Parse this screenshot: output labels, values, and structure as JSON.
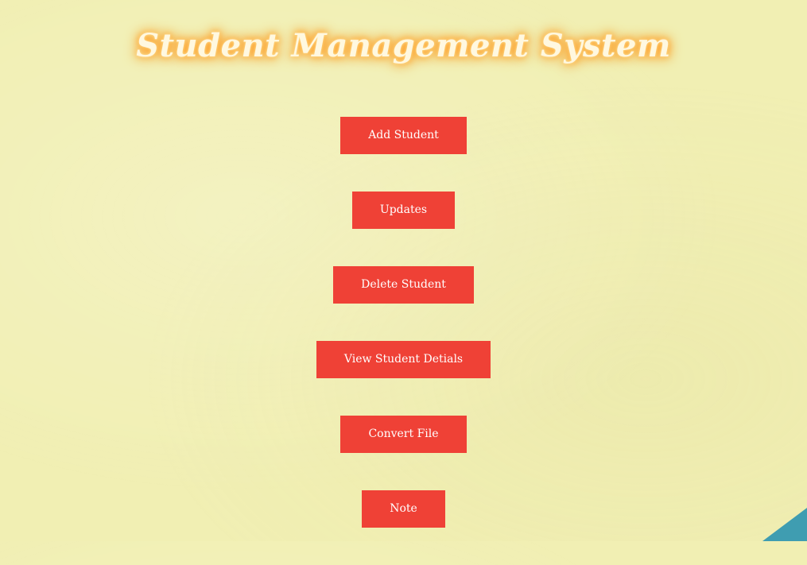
{
  "page": {
    "title": "Student Management System"
  },
  "menu": {
    "buttons": [
      {
        "label": "Add Student"
      },
      {
        "label": "Updates"
      },
      {
        "label": "Delete Student"
      },
      {
        "label": "View Student Detials"
      },
      {
        "label": "Convert File"
      },
      {
        "label": "Note"
      }
    ]
  },
  "colors": {
    "background": "#f1efb3",
    "button": "#ef4136",
    "button_text": "#ffffff",
    "title_glow": "#ff8a00",
    "corner_accent": "#3f9db1"
  }
}
